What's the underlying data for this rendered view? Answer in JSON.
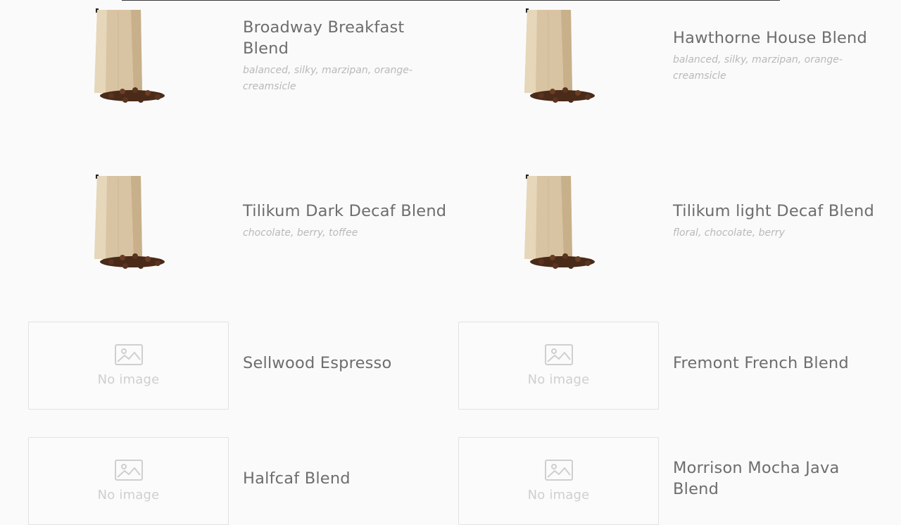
{
  "products": [
    {
      "name": "Broadway Breakfast Blend",
      "notes": "balanced, silky, marzipan, orange-creamsicle",
      "image": "coffee-bag"
    },
    {
      "name": "Hawthorne House Blend",
      "notes": "balanced, silky, marzipan, orange-creamsicle",
      "image": "coffee-bag"
    },
    {
      "name": "Tilikum Dark Decaf Blend",
      "notes": "chocolate, berry, toffee",
      "image": "coffee-bag"
    },
    {
      "name": "Tilikum light Decaf Blend",
      "notes": "floral, chocolate, berry",
      "image": "coffee-bag"
    },
    {
      "name": "Sellwood Espresso",
      "notes": "",
      "image": "no-image",
      "image_placeholder": "No image"
    },
    {
      "name": "Fremont French Blend",
      "notes": "",
      "image": "no-image",
      "image_placeholder": "No image"
    },
    {
      "name": "Halfcaf Blend",
      "notes": "",
      "image": "no-image",
      "image_placeholder": "No image"
    },
    {
      "name": "Morrison Mocha Java Blend",
      "notes": "",
      "image": "no-image",
      "image_placeholder": "No image"
    }
  ],
  "colors": {
    "background": "#fafafa",
    "product_name": "#6d6d6d",
    "tasting_notes": "#b9b9b9",
    "placeholder_border": "#e2e2e2",
    "placeholder_text": "#cfcfcf"
  }
}
